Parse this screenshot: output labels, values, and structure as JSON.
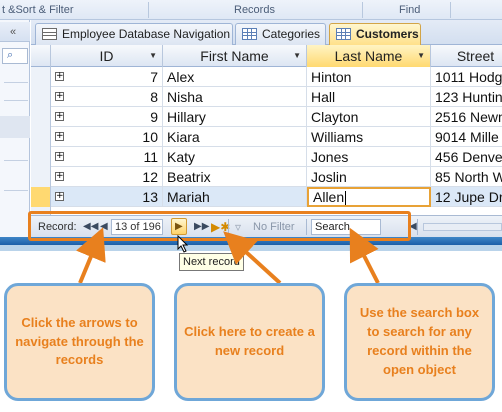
{
  "ribbon": {
    "groups": [
      "t &Sort & Filter",
      "Records",
      "Find"
    ]
  },
  "tabs": [
    {
      "label": "Employee Database Navigation",
      "icon": "form-icon",
      "active": false
    },
    {
      "label": "Categories",
      "icon": "table-icon",
      "active": false
    },
    {
      "label": "Customers",
      "icon": "table-icon",
      "active": true
    }
  ],
  "columns": [
    "ID",
    "First Name",
    "Last Name",
    "Street"
  ],
  "rows": [
    {
      "id": "7",
      "first": "Alex",
      "last": "Hinton",
      "street": "1011 Hodg"
    },
    {
      "id": "8",
      "first": "Nisha",
      "last": "Hall",
      "street": "123 Huntin"
    },
    {
      "id": "9",
      "first": "Hillary",
      "last": "Clayton",
      "street": "2516 Newm"
    },
    {
      "id": "10",
      "first": "Kiara",
      "last": "Williams",
      "street": "9014 Mille"
    },
    {
      "id": "11",
      "first": "Katy",
      "last": "Jones",
      "street": "456 Denve"
    },
    {
      "id": "12",
      "first": "Beatrix",
      "last": "Joslin",
      "street": "85 North W"
    },
    {
      "id": "13",
      "first": "Mariah",
      "last": "Allen",
      "street": "12 Jupe Dr"
    }
  ],
  "record_nav": {
    "label": "Record:",
    "position": "13 of 196",
    "filter_label": "No Filter",
    "search_value": "Search"
  },
  "tooltip": "Next record",
  "callouts": [
    "Click the arrows to navigate through the records",
    "Click here to create a new record",
    "Use the search box to search for any record within the open object"
  ],
  "colors": {
    "accent_orange": "#e8801e",
    "callout_fill": "#fbe2c5",
    "callout_border": "#6fa7d8"
  }
}
